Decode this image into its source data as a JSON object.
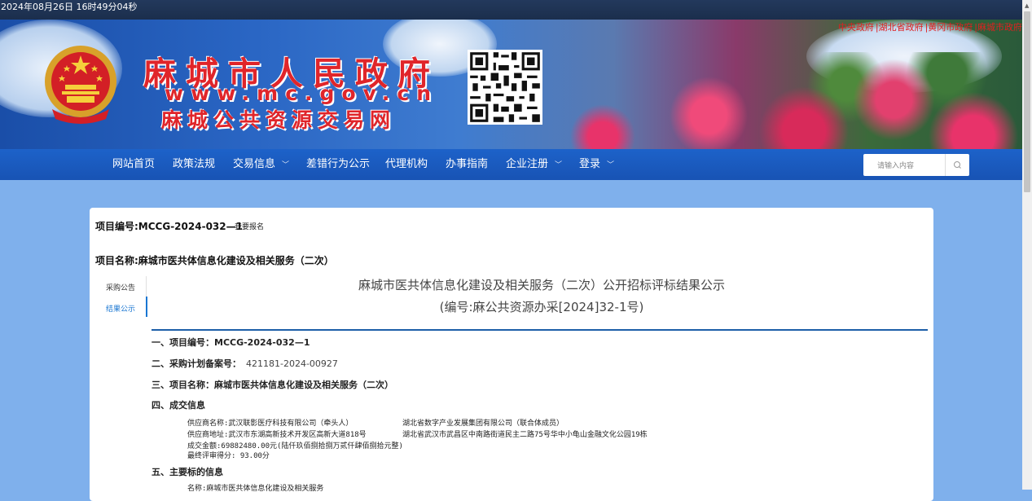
{
  "clock": "2024年08月26日 16时49分04秒",
  "gov_links": [
    "中央政府",
    "|湖北省政府",
    "|黄冈市政府",
    "|麻城市政府"
  ],
  "site": {
    "title": "麻城市人民政府",
    "url": "www.mc.gov.cn",
    "subtitle": "麻城公共资源交易网"
  },
  "nav": {
    "items": [
      {
        "label": "网站首页",
        "dropdown": false
      },
      {
        "label": "政策法规",
        "dropdown": false
      },
      {
        "label": "交易信息",
        "dropdown": true
      },
      {
        "label": "差错行为公示",
        "dropdown": false
      },
      {
        "label": "代理机构",
        "dropdown": false
      },
      {
        "label": "办事指南",
        "dropdown": false
      },
      {
        "label": "企业注册",
        "dropdown": true
      },
      {
        "label": "登录",
        "dropdown": true
      }
    ],
    "search_placeholder": "请输入内容"
  },
  "project": {
    "number_line": "项目编号:MCCG-2024-032—1",
    "signup": "我要报名",
    "name_line": "项目名称:麻城市医共体信息化建设及相关服务（二次）"
  },
  "side_tabs": [
    "采购公告",
    "结果公示"
  ],
  "document": {
    "title": "麻城市医共体信息化建设及相关服务（二次）公开招标评标结果公示",
    "code": "(编号:麻公共资源办采[2024]32-1号)",
    "sections": [
      {
        "label": "一、项目编号：MCCG-2024-032—1",
        "value": ""
      },
      {
        "label": "二、采购计划备案号：",
        "value": "421181-2024-00927"
      },
      {
        "label": "三、项目名称：麻城市医共体信息化建设及相关服务（二次）",
        "value": ""
      },
      {
        "label": "四、成交信息",
        "value": ""
      },
      {
        "label": "五、主要标的信息",
        "value": ""
      }
    ],
    "deal_lines": [
      {
        "left": "供应商名称:武汉联影医疗科技有限公司（牵头人）",
        "right": "湖北省数字产业发展集团有限公司（联合体成员）"
      },
      {
        "left": "供应商地址:武汉市东湖高新技术开发区高新大道818号",
        "right": "湖北省武汉市武昌区中南路街道民主二路75号华中小龟山金融文化公园19栋"
      },
      {
        "left": "成交金额:69882480.00元(陆仟玖佰捌拾捌万贰仟肆佰捌拾元整)",
        "right": ""
      },
      {
        "left": "最终评审得分: 93.00分",
        "right": ""
      }
    ],
    "main_item_line": "名称:麻城市医共体信息化建设及相关服务"
  }
}
